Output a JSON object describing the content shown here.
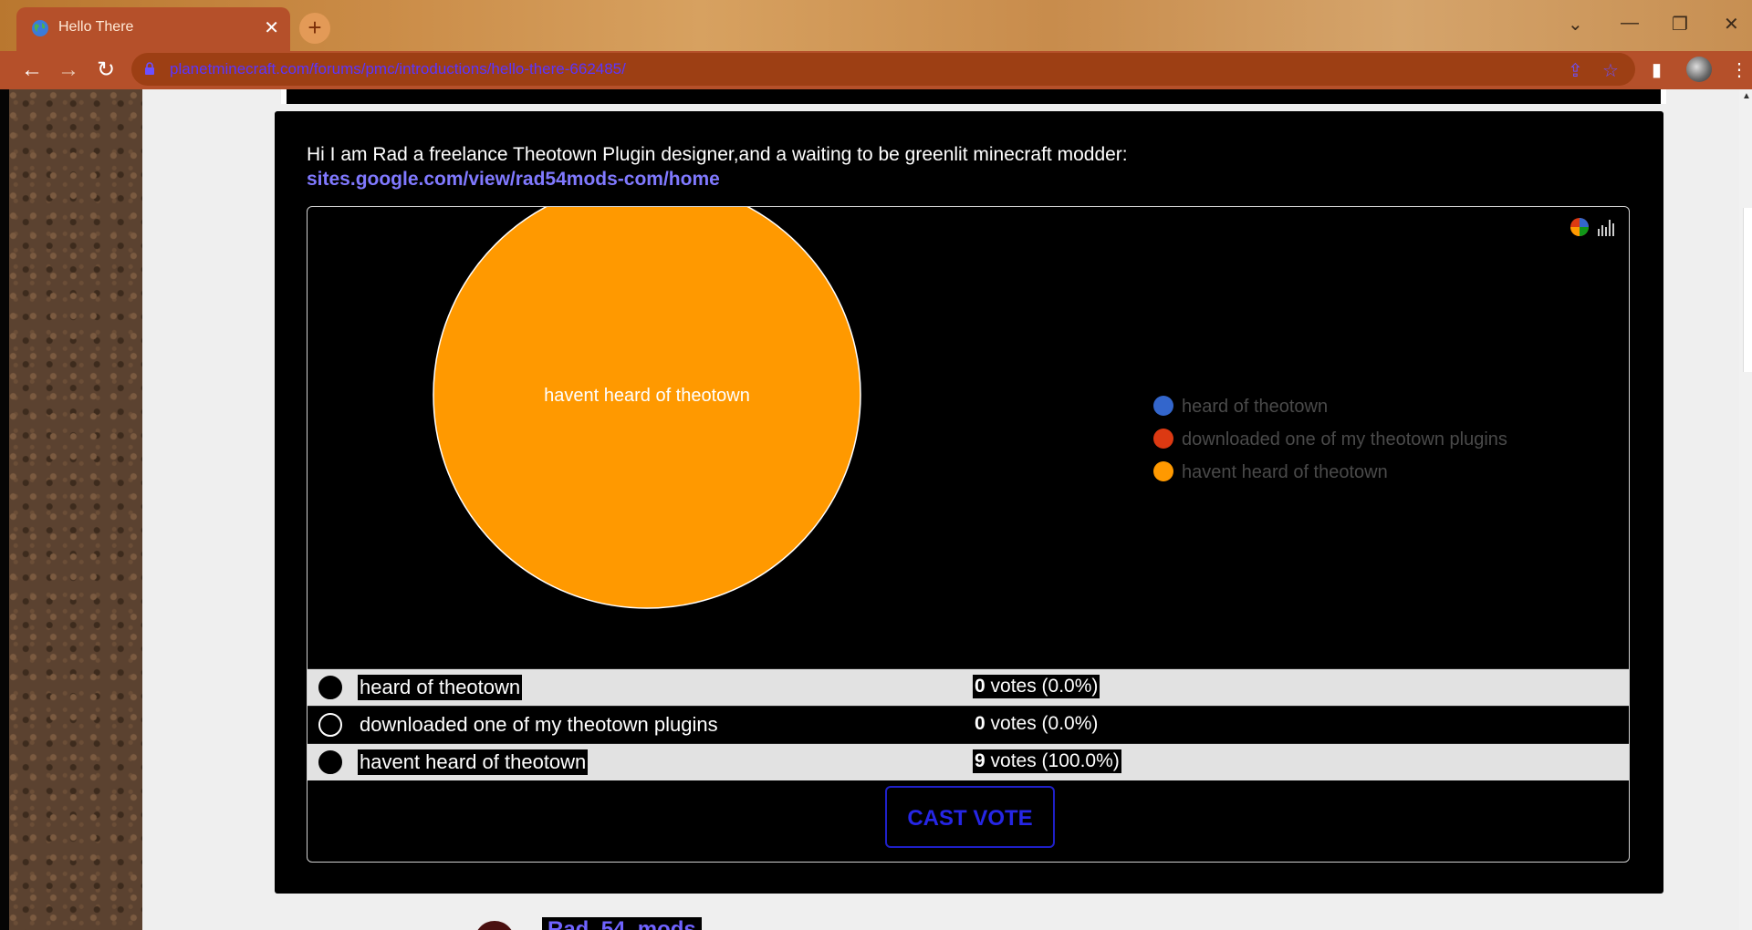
{
  "browser": {
    "tab_title": "Hello There",
    "tab_close": "✕",
    "new_tab": "+",
    "url": "planetminecraft.com/forums/pmc/introductions/hello-there-662485/",
    "window_controls": {
      "dropdown": "⌄",
      "minimize": "—",
      "restore": "❐",
      "close": "✕"
    },
    "icons": [
      "back-icon",
      "forward-icon",
      "reload-icon",
      "lock-icon",
      "share-icon",
      "star-icon",
      "sidebar-icon",
      "profile-avatar",
      "menu-icon"
    ]
  },
  "post": {
    "intro_text": "Hi I am Rad a freelance Theotown Plugin designer,and a waiting to be greenlit minecraft modder:",
    "link_text": "sites.google.com/view/rad54mods-com/home"
  },
  "poll": {
    "chart_data": {
      "type": "pie",
      "categories": [
        "heard of theotown",
        "downloaded one of my theotown plugins",
        "havent heard of theotown"
      ],
      "values": [
        0,
        0,
        9
      ],
      "colors": [
        "#3366cc",
        "#dc3912",
        "#ff9900"
      ],
      "slice_labels": [
        "",
        "",
        "havent heard of theotown"
      ],
      "legend_position": "right"
    },
    "options": [
      {
        "label": "heard of theotown",
        "votes_count": "0",
        "votes_text": " votes (0.0%)",
        "style": "light"
      },
      {
        "label": "downloaded one of my theotown plugins",
        "votes_count": "0",
        "votes_text": " votes (0.0%)",
        "style": "dark"
      },
      {
        "label": "havent heard of theotown",
        "votes_count": "9",
        "votes_text": " votes (100.0%)",
        "style": "light"
      }
    ],
    "cast_vote_label": "CAST VOTE"
  },
  "next_post": {
    "author": "Rad_54_mods"
  }
}
